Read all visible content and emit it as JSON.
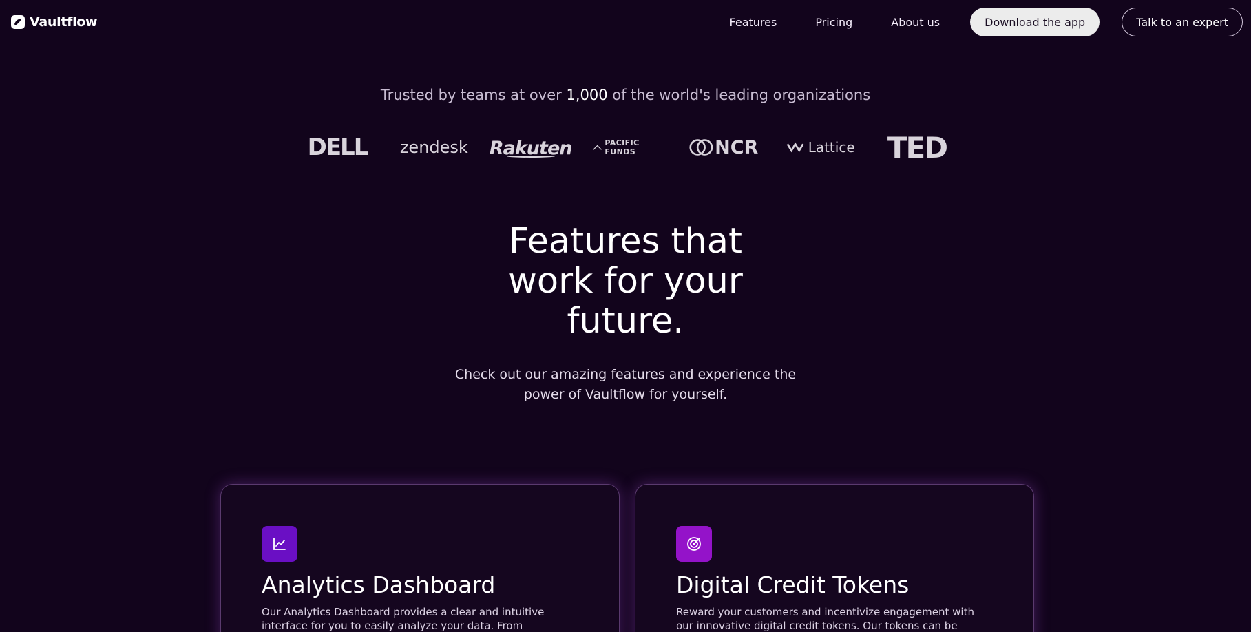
{
  "header": {
    "brand": "Vaultflow",
    "nav": [
      "Features",
      "Pricing",
      "About us"
    ],
    "download_button": "Download the app",
    "expert_button": "Talk to an expert"
  },
  "trusted": {
    "prefix": "Trusted by teams at over ",
    "count": "1,000",
    "suffix": " of the world's leading organizations",
    "logos": [
      "DELL",
      "zendesk",
      "Rakuten",
      "PACIFIC FUNDS",
      "NCR",
      "Lattice",
      "TED"
    ]
  },
  "hero": {
    "title_line1": "Features that",
    "title_line2": "work for your",
    "title_line3": "future.",
    "subtitle_line1": "Check out our amazing features and experience the",
    "subtitle_line2": "power of Vaultflow for yourself."
  },
  "features": [
    {
      "icon": "line-chart-icon",
      "title": "Analytics Dashboard",
      "text": "Our Analytics Dashboard provides a clear and intuitive interface for you to easily analyze your data. From customizable graphs to"
    },
    {
      "icon": "target-icon",
      "title": "Digital Credit Tokens",
      "text": "Reward your customers and incentivize engagement with our innovative digital credit tokens. Our tokens can be customized to"
    }
  ],
  "colors": {
    "background": "#12041c",
    "analytics_icon_bg": "#6a0fc4",
    "tokens_icon_bg": "#9413c9",
    "download_button_bg": "#ececec"
  }
}
